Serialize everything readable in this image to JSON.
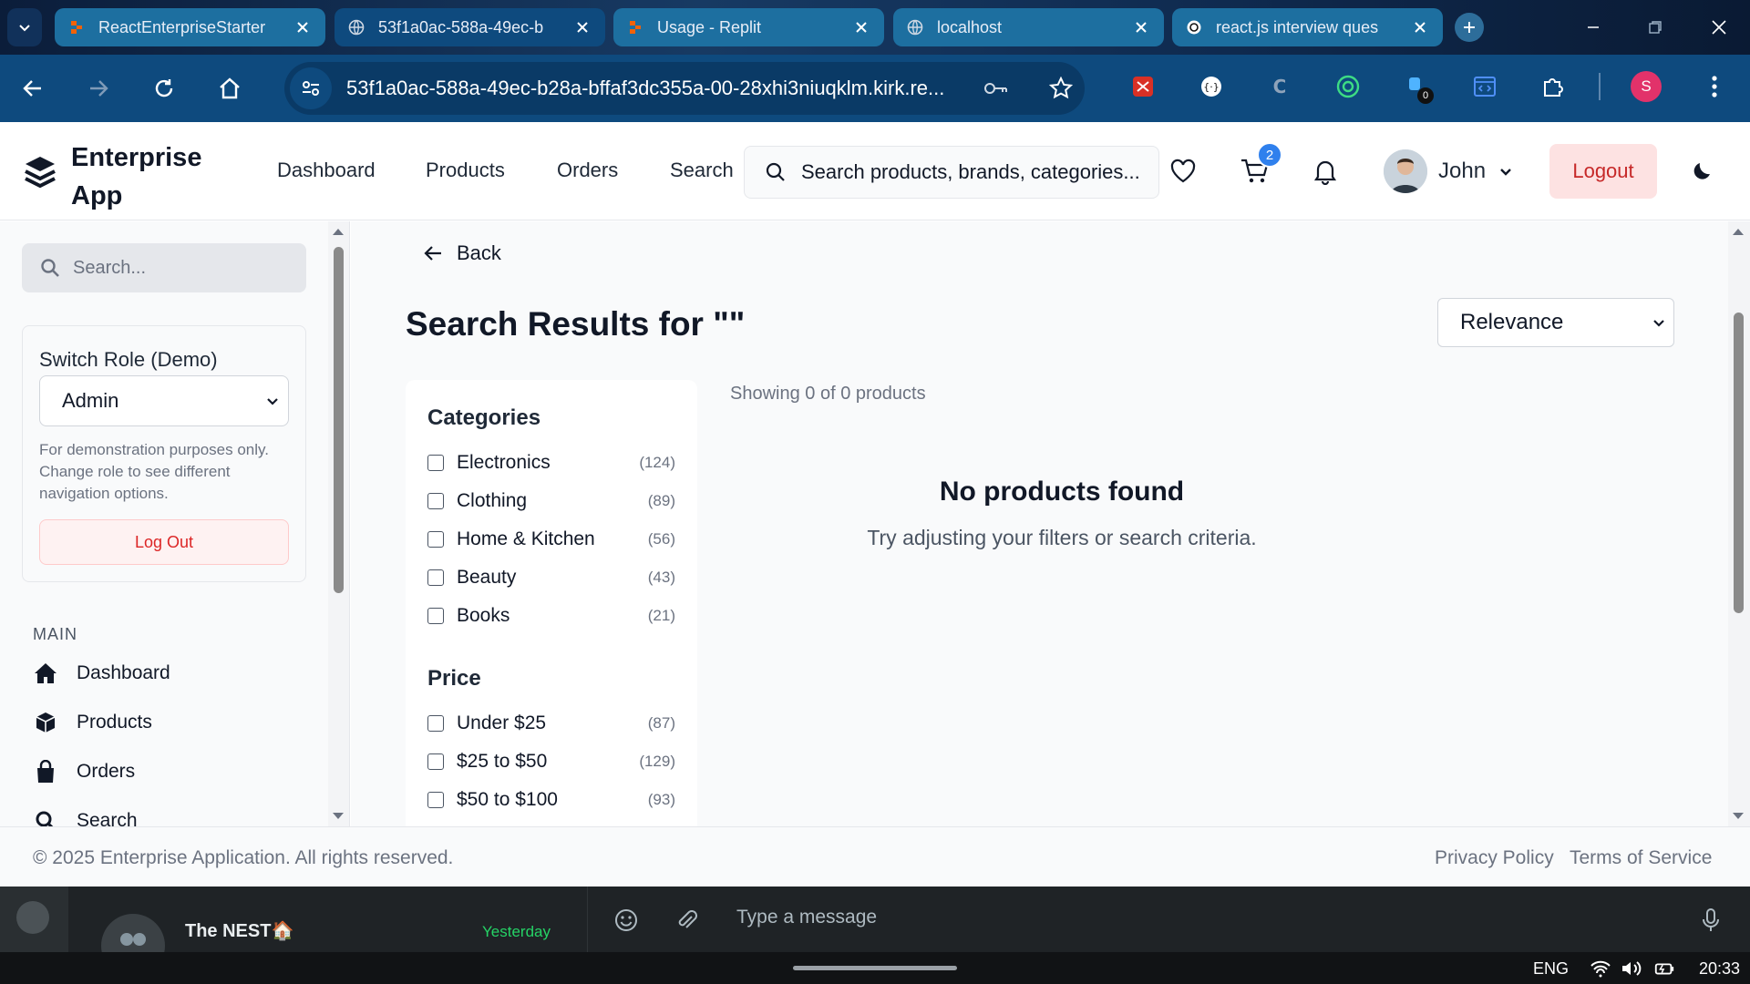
{
  "browser": {
    "tabs": [
      {
        "title": "ReactEnterpriseStarter",
        "icon": "replit-icon",
        "active": false
      },
      {
        "title": "53f1a0ac-588a-49ec-b",
        "icon": "globe-icon",
        "active": true
      },
      {
        "title": "Usage - Replit",
        "icon": "replit-icon",
        "active": false
      },
      {
        "title": "localhost",
        "icon": "globe-icon",
        "active": false
      },
      {
        "title": "react.js interview ques",
        "icon": "openai-icon",
        "active": false
      }
    ],
    "url": "53f1a0ac-588a-49ec-b28a-bffaf3dc355a-00-28xhi3niuqklm.kirk.re...",
    "extension_badge": "0",
    "profile_initial": "S"
  },
  "header": {
    "logo_line1": "Enterprise",
    "logo_line2": "App",
    "nav": [
      "Dashboard",
      "Products",
      "Orders",
      "Search"
    ],
    "search_placeholder": "Search products, brands, categories...",
    "cart_count": "2",
    "user_name": "John",
    "logout_label": "Logout"
  },
  "sidebar": {
    "search_placeholder": "Search...",
    "role_title": "Switch Role (Demo)",
    "role_value": "Admin",
    "role_note": "For demonstration purposes only. Change role to see different navigation options.",
    "role_logout": "Log Out",
    "section_label": "MAIN",
    "items": [
      {
        "label": "Dashboard",
        "icon": "home-icon"
      },
      {
        "label": "Products",
        "icon": "boxes-icon"
      },
      {
        "label": "Orders",
        "icon": "bag-icon"
      },
      {
        "label": "Search",
        "icon": "search-icon"
      }
    ]
  },
  "main": {
    "back_label": "Back",
    "title": "Search Results for \"\"",
    "sort_value": "Relevance",
    "showing": "Showing 0 of 0 products",
    "empty_title": "No products found",
    "empty_sub": "Try adjusting your filters or search criteria.",
    "filters": {
      "categories_head": "Categories",
      "categories": [
        {
          "label": "Electronics",
          "count": "(124)"
        },
        {
          "label": "Clothing",
          "count": "(89)"
        },
        {
          "label": "Home & Kitchen",
          "count": "(56)"
        },
        {
          "label": "Beauty",
          "count": "(43)"
        },
        {
          "label": "Books",
          "count": "(21)"
        }
      ],
      "price_head": "Price",
      "price": [
        {
          "label": "Under $25",
          "count": "(87)"
        },
        {
          "label": "$25 to $50",
          "count": "(129)"
        },
        {
          "label": "$50 to $100",
          "count": "(93)"
        }
      ]
    }
  },
  "footer": {
    "copyright": "© 2025 Enterprise Application. All rights reserved.",
    "privacy": "Privacy Policy",
    "terms": "Terms of Service"
  },
  "chat": {
    "group_name": "The NEST🏠",
    "time": "Yesterday",
    "input_placeholder": "Type a message"
  },
  "taskbar": {
    "language": "ENG",
    "time": "20:33"
  },
  "colors": {
    "browser_toolbar": "#0e4a7e",
    "logout_bg": "#fde2e2",
    "logout_text": "#c62828",
    "cart_badge": "#2f80ed"
  }
}
